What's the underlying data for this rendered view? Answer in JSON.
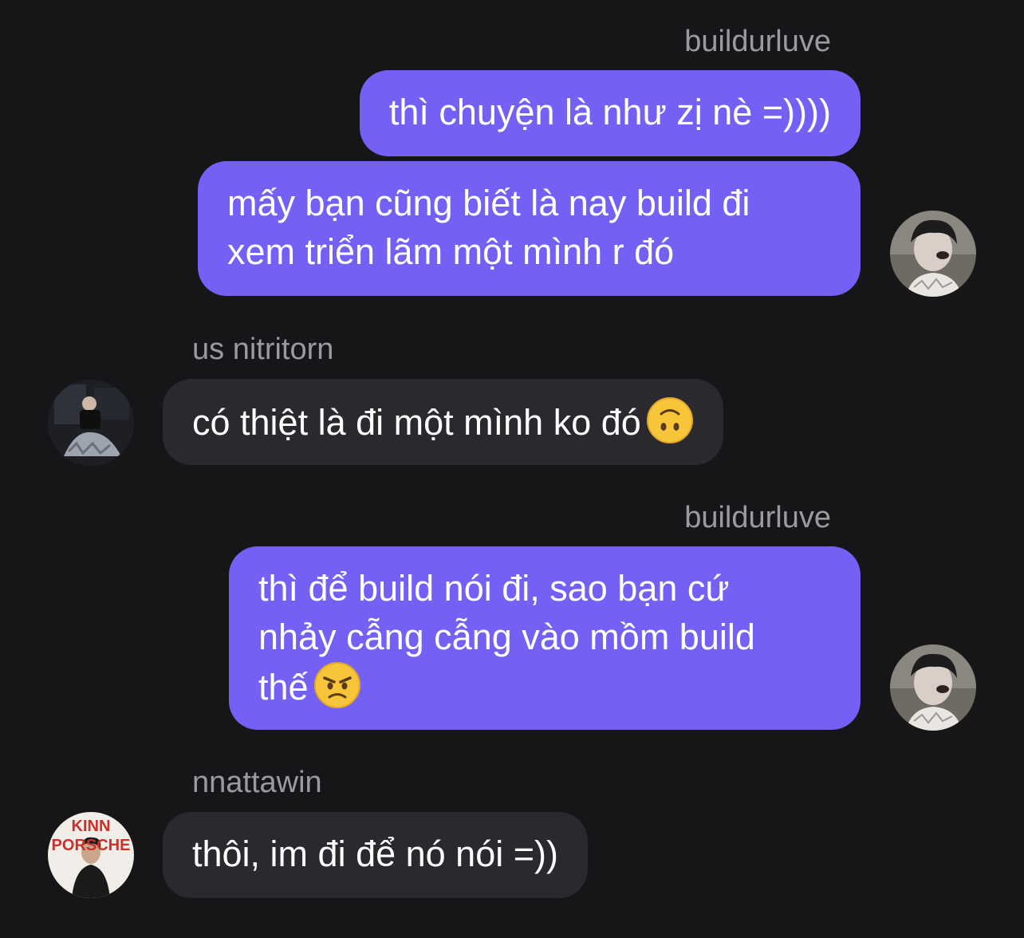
{
  "messages": [
    {
      "sender": "buildurluve",
      "direction": "outgoing",
      "bubbles": [
        {
          "lines": [
            "thì chuyện là như zị nè =))))"
          ]
        },
        {
          "lines": [
            "mấy bạn cũng biết là nay build đi",
            "xem triển lãm một mình r đó"
          ]
        }
      ],
      "avatar": "avatar-buildurluve"
    },
    {
      "sender": "us nitritorn",
      "direction": "incoming",
      "bubbles": [
        {
          "lines": [
            "có thiệt là đi một mình ko đó"
          ],
          "emoji": "upside-down-face-emoji"
        }
      ],
      "avatar": "avatar-us-nitritorn"
    },
    {
      "sender": "buildurluve",
      "direction": "outgoing",
      "bubbles": [
        {
          "lines": [
            "thì để build nói đi, sao bạn cứ",
            "nhảy cẫng cẫng vào mồm build",
            "thế"
          ],
          "emoji": "angry-face-emoji"
        }
      ],
      "avatar": "avatar-buildurluve"
    },
    {
      "sender": "nnattawin",
      "direction": "incoming",
      "bubbles": [
        {
          "lines": [
            "thôi, im đi để nó nói =))"
          ]
        }
      ],
      "avatar": "avatar-nnattawin",
      "avatar_text": [
        "KINN",
        "PORSCHE"
      ]
    }
  ],
  "colors": {
    "background": "#161618",
    "outgoing_bubble": "#7460f5",
    "incoming_bubble": "#2a2a2e",
    "sender_name": "#9a9aa0",
    "text": "#ffffff"
  }
}
